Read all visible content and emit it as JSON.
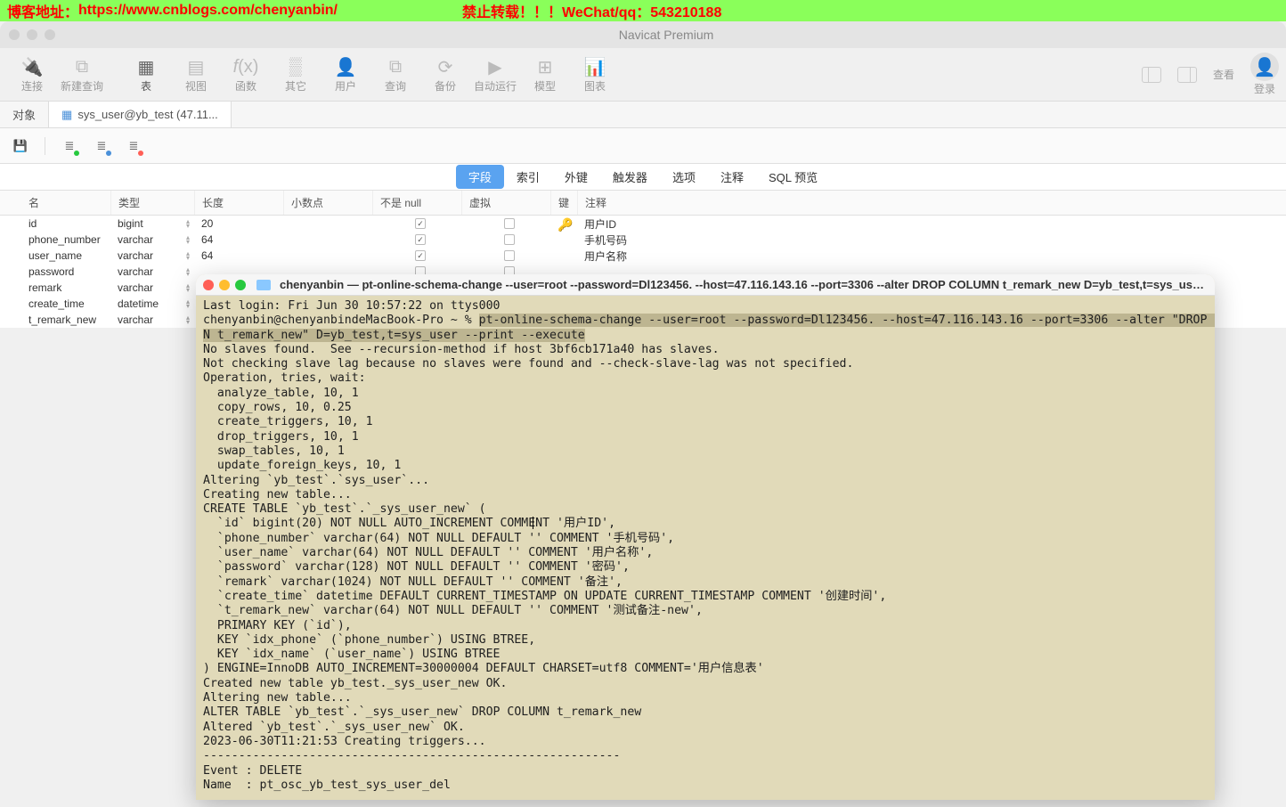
{
  "banner": {
    "blog_label": "博客地址：",
    "url": "https://www.cnblogs.com/chenyanbin/",
    "warn": "禁止转载！！！WeChat/qq：543210188"
  },
  "window": {
    "title": "Navicat Premium"
  },
  "toolbar": {
    "items": [
      {
        "label": "连接"
      },
      {
        "label": "新建查询"
      },
      {
        "label": "表"
      },
      {
        "label": "视图"
      },
      {
        "label": "函数"
      },
      {
        "label": "其它"
      },
      {
        "label": "用户"
      },
      {
        "label": "查询"
      },
      {
        "label": "备份"
      },
      {
        "label": "自动运行"
      },
      {
        "label": "模型"
      },
      {
        "label": "图表"
      }
    ],
    "right_view": "查看",
    "right_login": "登录"
  },
  "tabs": {
    "obj": "对象",
    "current": "sys_user@yb_test (47.11..."
  },
  "subtabs": [
    "字段",
    "索引",
    "外键",
    "触发器",
    "选项",
    "注释",
    "SQL 预览"
  ],
  "grid": {
    "headers": {
      "name": "名",
      "type": "类型",
      "len": "长度",
      "dec": "小数点",
      "notnull": "不是 null",
      "virtual": "虚拟",
      "key": "键",
      "comment": "注释"
    },
    "rows": [
      {
        "name": "id",
        "type": "bigint",
        "len": "20",
        "notnull": true,
        "virtual": false,
        "key": true,
        "comment": "用户ID"
      },
      {
        "name": "phone_number",
        "type": "varchar",
        "len": "64",
        "notnull": true,
        "virtual": false,
        "key": false,
        "comment": "手机号码"
      },
      {
        "name": "user_name",
        "type": "varchar",
        "len": "64",
        "notnull": true,
        "virtual": false,
        "key": false,
        "comment": "用户名称"
      },
      {
        "name": "password",
        "type": "varchar",
        "len": "",
        "notnull": false,
        "virtual": false,
        "key": false,
        "comment": ""
      },
      {
        "name": "remark",
        "type": "varchar",
        "len": "",
        "notnull": false,
        "virtual": false,
        "key": false,
        "comment": ""
      },
      {
        "name": "create_time",
        "type": "datetime",
        "len": "",
        "notnull": false,
        "virtual": false,
        "key": false,
        "comment": ""
      },
      {
        "name": "t_remark_new",
        "type": "varchar",
        "len": "",
        "notnull": false,
        "virtual": false,
        "key": false,
        "comment": ""
      }
    ]
  },
  "terminal": {
    "title": "chenyanbin — pt-online-schema-change --user=root --password=Dl123456. --host=47.116.143.16 --port=3306 --alter DROP COLUMN t_remark_new D=yb_test,t=sys_use...",
    "line_last_login": "Last login: Fri Jun 30 10:57:22 on ttys000",
    "prompt_user": "chenyanbin@chenyanbindeMacBook-Pro ~ % ",
    "cmd_part1": "pt-online-schema-change --user=root --password=Dl123456. --host=47.116.143.16 --port=3306 --alter \"DROP COLUM",
    "cmd_part2": "N t_remark_new\" D=yb_test,t=sys_user --print --execute",
    "rest": "No slaves found.  See --recursion-method if host 3bf6cb171a40 has slaves.\nNot checking slave lag because no slaves were found and --check-slave-lag was not specified.\nOperation, tries, wait:\n  analyze_table, 10, 1\n  copy_rows, 10, 0.25\n  create_triggers, 10, 1\n  drop_triggers, 10, 1\n  swap_tables, 10, 1\n  update_foreign_keys, 10, 1\nAltering `yb_test`.`sys_user`...\nCreating new table...\nCREATE TABLE `yb_test`.`_sys_user_new` (\n  `id` bigint(20) NOT NULL AUTO_INCREMENT COMMENT '用户ID',\n  `phone_number` varchar(64) NOT NULL DEFAULT '' COMMENT '手机号码',\n  `user_name` varchar(64) NOT NULL DEFAULT '' COMMENT '用户名称',\n  `password` varchar(128) NOT NULL DEFAULT '' COMMENT '密码',\n  `remark` varchar(1024) NOT NULL DEFAULT '' COMMENT '备注',\n  `create_time` datetime DEFAULT CURRENT_TIMESTAMP ON UPDATE CURRENT_TIMESTAMP COMMENT '创建时间',\n  `t_remark_new` varchar(64) NOT NULL DEFAULT '' COMMENT '测试备注-new',\n  PRIMARY KEY (`id`),\n  KEY `idx_phone` (`phone_number`) USING BTREE,\n  KEY `idx_name` (`user_name`) USING BTREE\n) ENGINE=InnoDB AUTO_INCREMENT=30000004 DEFAULT CHARSET=utf8 COMMENT='用户信息表'\nCreated new table yb_test._sys_user_new OK.\nAltering new table...\nALTER TABLE `yb_test`.`_sys_user_new` DROP COLUMN t_remark_new\nAltered `yb_test`.`_sys_user_new` OK.\n2023-06-30T11:21:53 Creating triggers...\n-----------------------------------------------------------\nEvent : DELETE\nName  : pt_osc_yb_test_sys_user_del"
  }
}
